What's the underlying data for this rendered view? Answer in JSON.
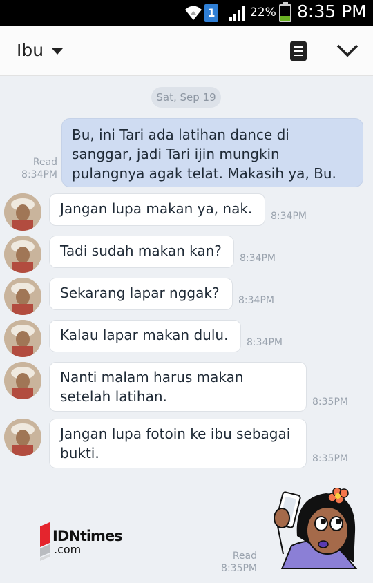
{
  "status_bar": {
    "badge": "1",
    "battery_percent": "22%",
    "time": "8:35 PM"
  },
  "header": {
    "contact_name": "Ibu",
    "icons": [
      "dropdown-caret-icon",
      "memo-icon",
      "chevron-down-icon"
    ]
  },
  "chat": {
    "date_separator": "Sat, Sep 19",
    "sent": [
      {
        "text": "Bu, ini Tari ada latihan dance di sanggar, jadi Tari ijin mungkin pulangnya agak telat. Makasih ya, Bu.",
        "status": "Read",
        "time": "8:34PM"
      },
      {
        "sticker": "girl-selfie-sticker",
        "status": "Read",
        "time": "8:35PM"
      }
    ],
    "received": [
      {
        "text": "Jangan lupa makan ya, nak.",
        "time": "8:34PM"
      },
      {
        "text": "Tadi sudah makan kan?",
        "time": "8:34PM"
      },
      {
        "text": "Sekarang lapar nggak?",
        "time": "8:34PM"
      },
      {
        "text": "Kalau lapar makan dulu.",
        "time": "8:34PM"
      },
      {
        "text": "Nanti malam harus makan setelah latihan.",
        "time": "8:35PM"
      },
      {
        "text": "Jangan lupa fotoin ke ibu sebagai bukti.",
        "time": "8:35PM"
      }
    ]
  },
  "watermark": {
    "name": "IDNtimes",
    "domain": ".com"
  },
  "colors": {
    "sent_bubble": "#cfdcf2",
    "received_bubble": "#ffffff",
    "background": "#edf0f4",
    "brand_red": "#e4252d"
  }
}
